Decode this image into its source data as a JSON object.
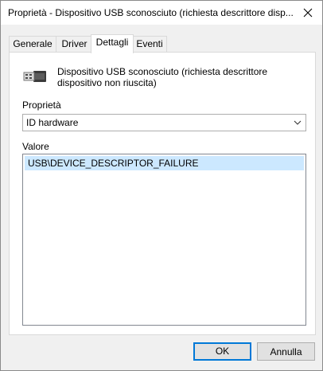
{
  "window": {
    "title": "Proprietà - Dispositivo USB sconosciuto (richiesta descrittore disp...",
    "close_icon": "close-icon"
  },
  "tabs": [
    {
      "label": "Generale",
      "active": false
    },
    {
      "label": "Driver",
      "active": false
    },
    {
      "label": "Dettagli",
      "active": true
    },
    {
      "label": "Eventi",
      "active": false
    }
  ],
  "details": {
    "device_icon": "usb-plug-icon",
    "device_name": "Dispositivo USB sconosciuto (richiesta descrittore dispositivo non riuscita)",
    "property_label": "Proprietà",
    "property_selected": "ID hardware",
    "value_label": "Valore",
    "values": [
      "USB\\DEVICE_DESCRIPTOR_FAILURE"
    ]
  },
  "buttons": {
    "ok": "OK",
    "cancel": "Annulla"
  },
  "colors": {
    "selection": "#cce8ff",
    "default_button_border": "#0078d7"
  }
}
